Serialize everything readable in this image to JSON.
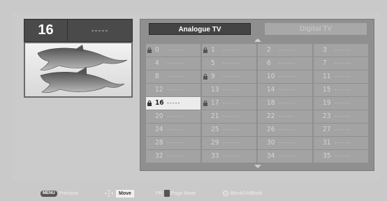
{
  "header": {
    "channel_number": "16",
    "channel_name": "-----"
  },
  "tabs": {
    "analogue": "Analogue TV",
    "digital": "Digital TV"
  },
  "channels": [
    {
      "num": "0",
      "name": "------",
      "locked": true,
      "selected": false
    },
    {
      "num": "1",
      "name": "------",
      "locked": true,
      "selected": false
    },
    {
      "num": "2",
      "name": "------",
      "locked": false,
      "selected": false
    },
    {
      "num": "3",
      "name": "------",
      "locked": false,
      "selected": false
    },
    {
      "num": "4",
      "name": "------",
      "locked": false,
      "selected": false
    },
    {
      "num": "5",
      "name": "------",
      "locked": false,
      "selected": false
    },
    {
      "num": "6",
      "name": "------",
      "locked": false,
      "selected": false
    },
    {
      "num": "7",
      "name": "------",
      "locked": false,
      "selected": false
    },
    {
      "num": "8",
      "name": "------",
      "locked": false,
      "selected": false
    },
    {
      "num": "9",
      "name": "------",
      "locked": true,
      "selected": false
    },
    {
      "num": "10",
      "name": "------",
      "locked": false,
      "selected": false
    },
    {
      "num": "11",
      "name": "------",
      "locked": false,
      "selected": false
    },
    {
      "num": "12",
      "name": "------",
      "locked": false,
      "selected": false
    },
    {
      "num": "13",
      "name": "------",
      "locked": false,
      "selected": false
    },
    {
      "num": "14",
      "name": "------",
      "locked": false,
      "selected": false
    },
    {
      "num": "15",
      "name": "------",
      "locked": false,
      "selected": false
    },
    {
      "num": "16",
      "name": "-----",
      "locked": true,
      "selected": true
    },
    {
      "num": "17",
      "name": "------",
      "locked": true,
      "selected": false
    },
    {
      "num": "18",
      "name": "------",
      "locked": false,
      "selected": false
    },
    {
      "num": "19",
      "name": "------",
      "locked": false,
      "selected": false
    },
    {
      "num": "20",
      "name": "------",
      "locked": false,
      "selected": false
    },
    {
      "num": "21",
      "name": "------",
      "locked": false,
      "selected": false
    },
    {
      "num": "22",
      "name": "------",
      "locked": false,
      "selected": false
    },
    {
      "num": "23",
      "name": "------",
      "locked": false,
      "selected": false
    },
    {
      "num": "24",
      "name": "------",
      "locked": false,
      "selected": false
    },
    {
      "num": "25",
      "name": "------",
      "locked": false,
      "selected": false
    },
    {
      "num": "26",
      "name": "------",
      "locked": false,
      "selected": false
    },
    {
      "num": "27",
      "name": "------",
      "locked": false,
      "selected": false
    },
    {
      "num": "28",
      "name": "------",
      "locked": false,
      "selected": false
    },
    {
      "num": "29",
      "name": "------",
      "locked": false,
      "selected": false
    },
    {
      "num": "30",
      "name": "------",
      "locked": false,
      "selected": false
    },
    {
      "num": "31",
      "name": "------",
      "locked": false,
      "selected": false
    },
    {
      "num": "32",
      "name": "------",
      "locked": false,
      "selected": false
    },
    {
      "num": "33",
      "name": "------",
      "locked": false,
      "selected": false
    },
    {
      "num": "34",
      "name": "------",
      "locked": false,
      "selected": false
    },
    {
      "num": "35",
      "name": "------",
      "locked": false,
      "selected": false
    }
  ],
  "guide": {
    "menu_key": "MENU",
    "previous": "Previous",
    "move": "Move",
    "pr_key": "PR",
    "page_move": "Page Move",
    "block": "Block/UnBlock"
  },
  "icons": [
    "lock-icon",
    "dolphin-image",
    "scroll-up-icon",
    "scroll-down-icon",
    "dpad-icon",
    "pr-key-icon",
    "ok-key-icon"
  ]
}
